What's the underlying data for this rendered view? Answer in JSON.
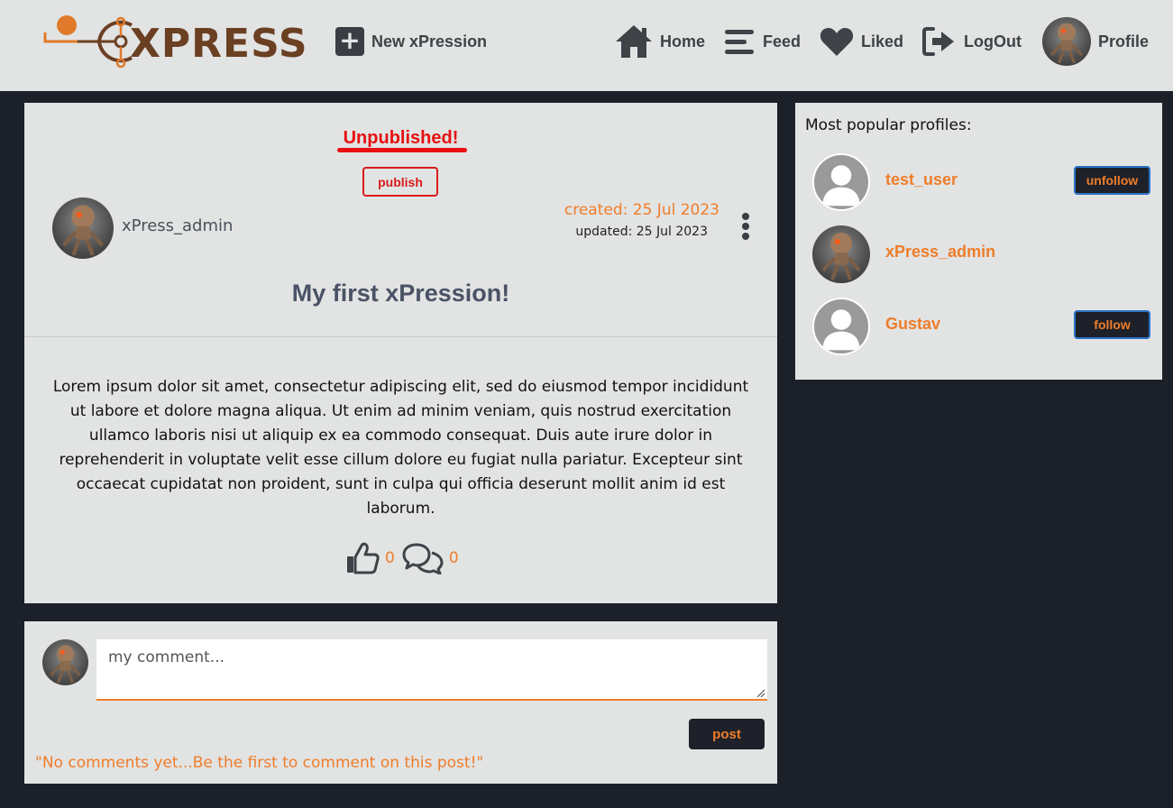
{
  "navbar": {
    "logo_text": "XPRESS",
    "new_xpression": "New xPression",
    "home": "Home",
    "feed": "Feed",
    "liked": "Liked",
    "logout": "LogOut",
    "profile": "Profile"
  },
  "post": {
    "status": "Unpublished!",
    "publish_label": "publish",
    "author": "xPress_admin",
    "created": "created: 25 Jul 2023",
    "updated": "updated: 25 Jul 2023",
    "title": "My first xPression!",
    "body": "Lorem ipsum dolor sit amet, consectetur adipiscing elit, sed do eiusmod tempor incididunt ut labore et dolore magna aliqua. Ut enim ad minim veniam, quis nostrud exercitation ullamco laboris nisi ut aliquip ex ea commodo consequat. Duis aute irure dolor in reprehenderit in voluptate velit esse cillum dolore eu fugiat nulla pariatur. Excepteur sint occaecat cupidatat non proident, sunt in culpa qui officia deserunt mollit anim id est laborum.",
    "likes": "0",
    "comments": "0"
  },
  "comment_form": {
    "placeholder": "my comment...",
    "post_label": "post",
    "empty_message": "\"No comments yet...Be the first to comment on this post!\""
  },
  "sidebar": {
    "title": "Most popular profiles:",
    "profiles": [
      {
        "name": "test_user",
        "avatar": "default-avatar",
        "action": "unfollow"
      },
      {
        "name": "xPress_admin",
        "avatar": "robot-avatar",
        "action": ""
      },
      {
        "name": "Gustav",
        "avatar": "default-avatar",
        "action": "follow"
      }
    ]
  },
  "colors": {
    "accent": "#ef7d2a",
    "background": "#1c2029",
    "card": "#e2e3e3",
    "alert": "#e81010",
    "button_dark": "#1e2129"
  },
  "icons": {
    "new": "plus-square-icon",
    "home": "house-icon",
    "feed": "bars-icon",
    "liked": "heart-icon",
    "logout": "logout-icon",
    "options": "kebab-vertical-icon",
    "like": "thumbs-up-icon",
    "comment": "comments-icon"
  }
}
